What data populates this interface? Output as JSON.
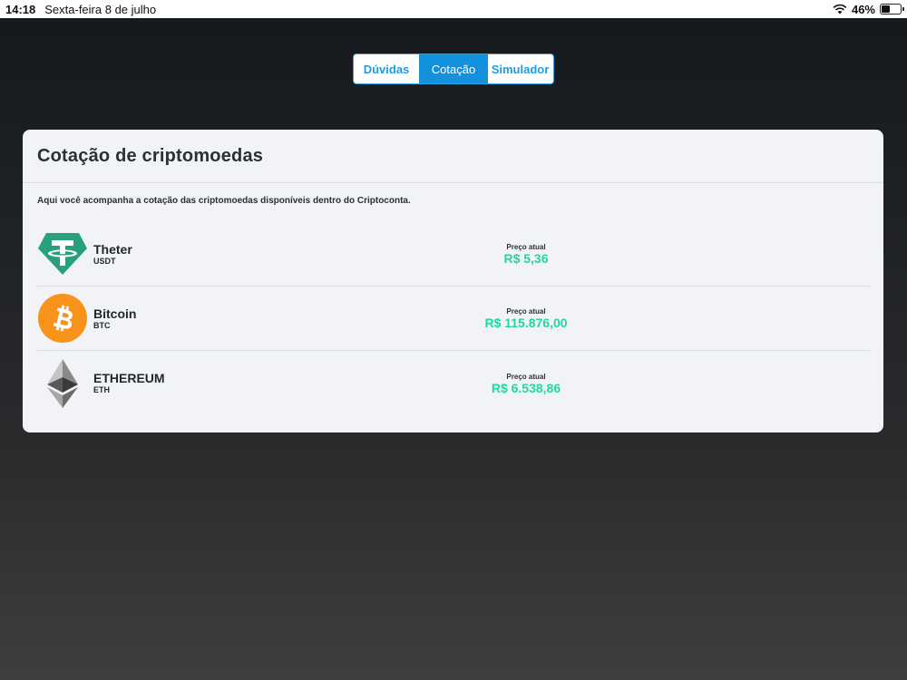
{
  "status_bar": {
    "time": "14:18",
    "date": "Sexta-feira 8 de julho",
    "battery": "46%",
    "battery_level": 0.46
  },
  "tabs": [
    {
      "label": "Dúvidas",
      "active": false
    },
    {
      "label": "Cotação",
      "active": true
    },
    {
      "label": "Simulador",
      "active": false
    }
  ],
  "card": {
    "title": "Cotação de criptomoedas",
    "description": "Aqui você acompanha a cotação das criptomoedas disponíveis dentro do Criptoconta."
  },
  "coins": [
    {
      "name": "Theter",
      "symbol": "USDT",
      "price_label": "Preço atual",
      "price": "R$ 5,36",
      "icon": "tether-icon",
      "color": "#26a17b"
    },
    {
      "name": "Bitcoin",
      "symbol": "BTC",
      "price_label": "Preço atual",
      "price": "R$ 115.876,00",
      "icon": "bitcoin-icon",
      "color": "#f7931a"
    },
    {
      "name": "ETHEREUM",
      "symbol": "ETH",
      "price_label": "Preço atual",
      "price": "R$ 6.538,86",
      "icon": "ethereum-icon",
      "color": "#3c3c3d"
    }
  ],
  "colors": {
    "accent": "#1391dd",
    "price": "#1ed8a0"
  }
}
